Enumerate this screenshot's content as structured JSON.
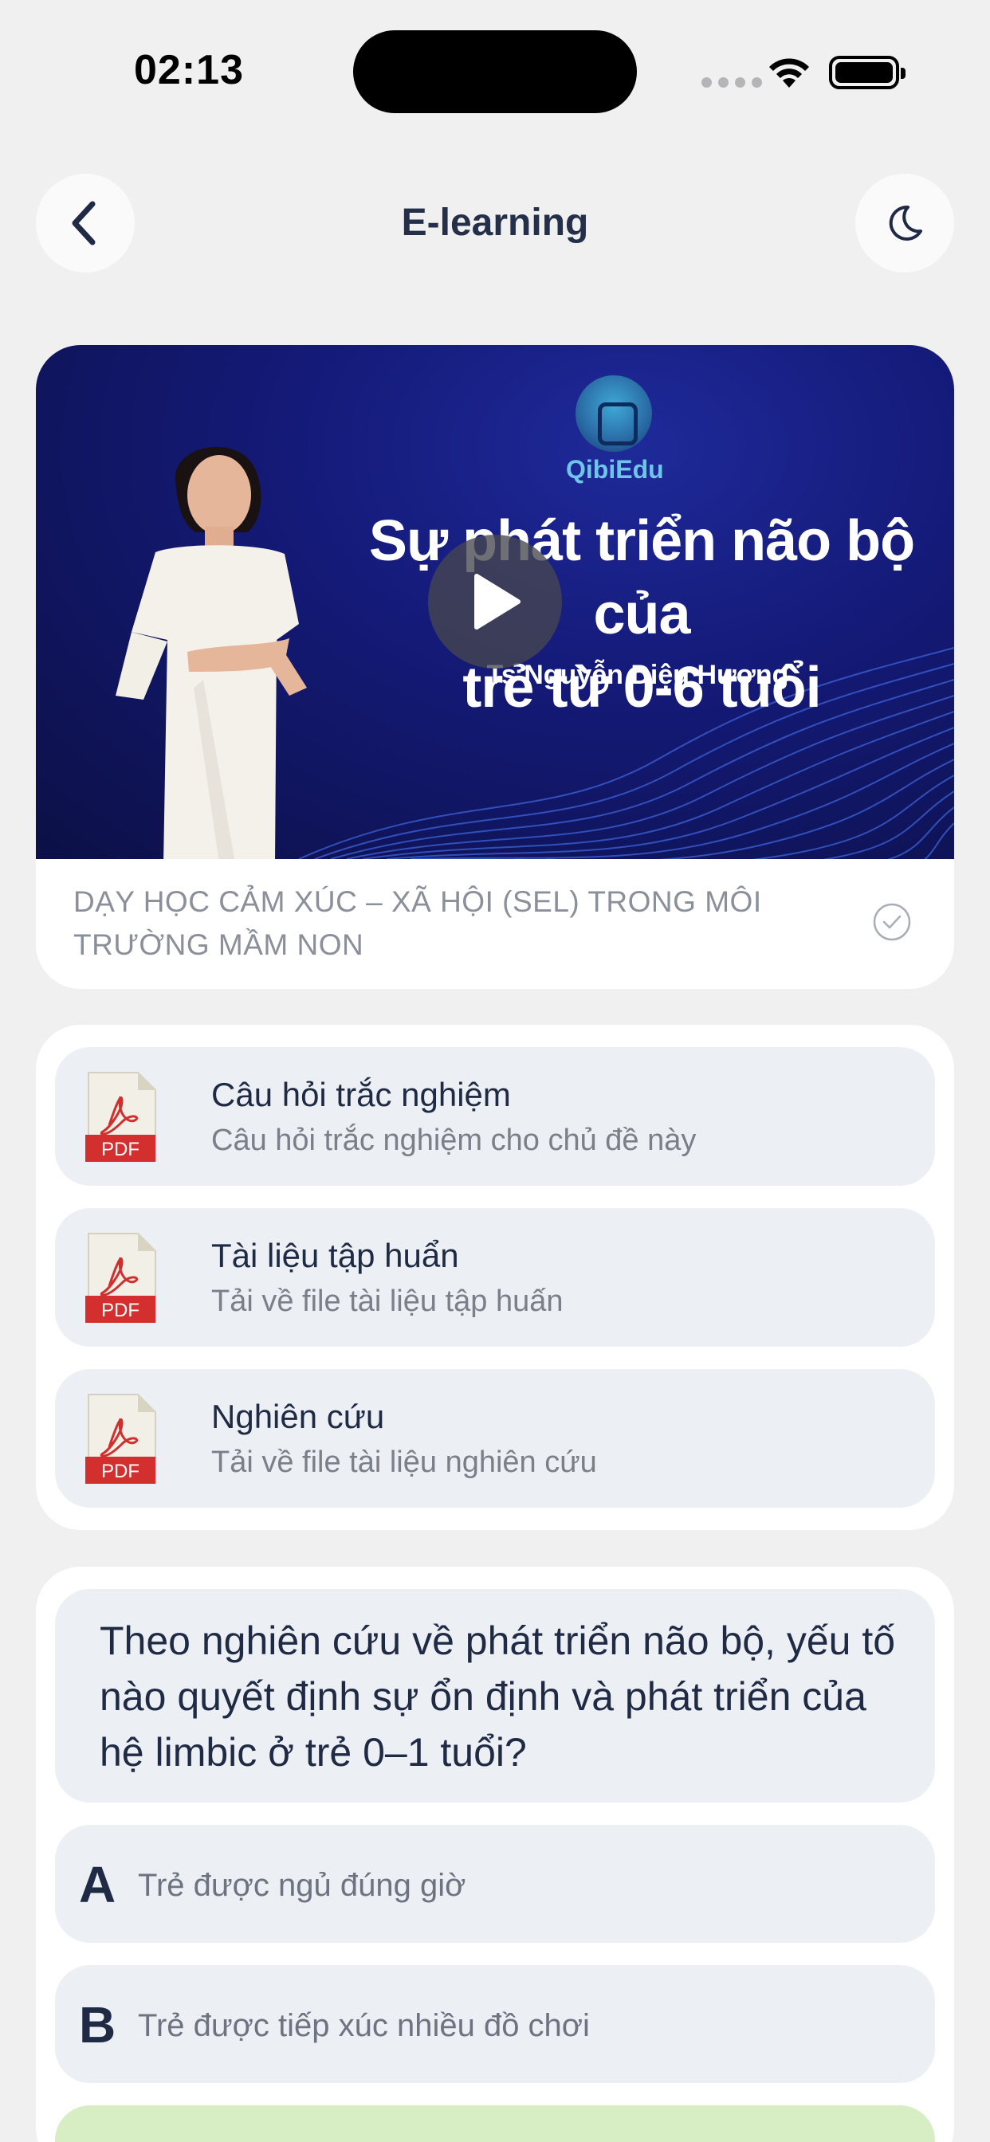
{
  "status_bar": {
    "time": "02:13"
  },
  "header": {
    "title": "E-learning",
    "back_icon": "chevron-left-icon",
    "theme_icon": "moon-icon"
  },
  "video": {
    "logo_text": "QibiEdu",
    "headline_line1": "Sự phát triển não bộ của",
    "headline_line2": "trẻ từ 0-6 tuổi",
    "presenter": "Ts Nguyễn Diệu Hương",
    "background_colors": [
      "#1f2a9a",
      "#0c1046"
    ],
    "play_icon": "play-icon"
  },
  "lesson": {
    "title": "DẠY HỌC CẢM XÚC – XÃ HỘI (SEL) TRONG MÔI TRƯỜNG MẦM NON",
    "status_icon": "check-circle-icon"
  },
  "resources": [
    {
      "title": "Câu hỏi trắc nghiệm",
      "subtitle": "Câu hỏi trắc nghiệm cho chủ đề này",
      "icon": "pdf-icon",
      "icon_label": "PDF"
    },
    {
      "title": "Tài liệu tập huẩn",
      "subtitle": "Tải về file tài liệu tập huấn",
      "icon": "pdf-icon",
      "icon_label": "PDF"
    },
    {
      "title": "Nghiên cứu",
      "subtitle": "Tải về file tài liệu nghiên cứu",
      "icon": "pdf-icon",
      "icon_label": "PDF"
    }
  ],
  "quiz": {
    "question": "Theo nghiên cứu về phát triển não bộ, yếu tố nào quyết định sự ổn định và phát triển của hệ limbic ở trẻ 0–1 tuổi?",
    "answers": [
      {
        "letter": "A",
        "text": "Trẻ được ngủ đúng giờ"
      },
      {
        "letter": "B",
        "text": "Trẻ được tiếp xúc nhiều đồ chơi"
      }
    ],
    "colors": {
      "answer_bg": "#eceff3",
      "selected_bg": "#d7edc3"
    }
  }
}
